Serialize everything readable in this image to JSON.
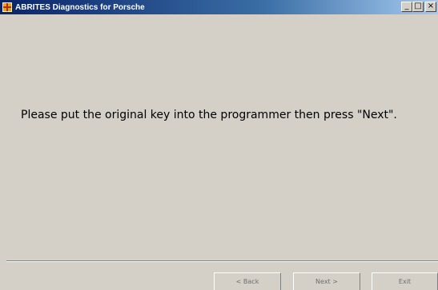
{
  "window": {
    "title": "ABRITES Diagnostics for Porsche",
    "controls": {
      "minimize": "_",
      "maximize": "□",
      "close": "×"
    }
  },
  "main": {
    "message": "Please put the original key into the programmer then press \"Next\"."
  },
  "footer": {
    "back_label": "< Back",
    "next_label": "Next >",
    "exit_label": "Exit"
  }
}
